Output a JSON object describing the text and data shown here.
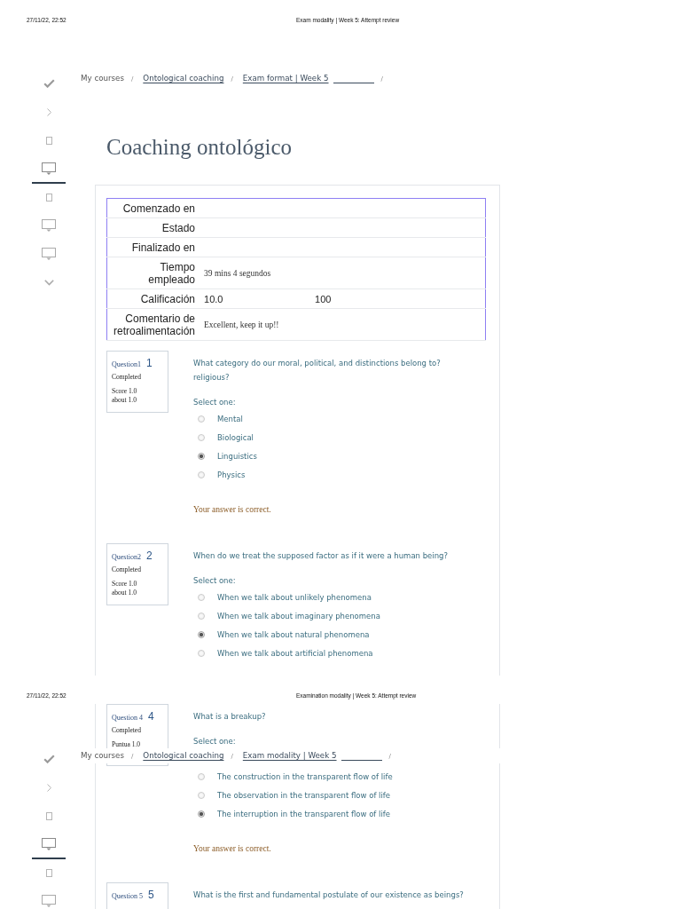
{
  "pages": [
    {
      "kind": "first",
      "header": {
        "date": "27/11/22, 22:52",
        "title": "Exam modality | Week 5: Attempt review"
      },
      "breadcrumb": [
        {
          "label": "My courses",
          "link": false,
          "underlined_blank": false,
          "separator": "/"
        },
        {
          "label": "Ontological coaching",
          "link": true,
          "underlined_blank": false,
          "separator": "/"
        },
        {
          "label": "Exam format | Week 5",
          "link": true,
          "underlined_blank": true,
          "separator": "/"
        }
      ],
      "sidebar": [
        {
          "kind": "check",
          "selected": false
        },
        {
          "kind": "chevron-right",
          "selected": false
        },
        {
          "kind": "document",
          "selected": false
        },
        {
          "kind": "monitor",
          "selected": true
        },
        {
          "kind": "document",
          "selected": false
        },
        {
          "kind": "monitor",
          "selected": false
        },
        {
          "kind": "monitor",
          "selected": false
        },
        {
          "kind": "chevron-down",
          "selected": false
        }
      ],
      "title": "Coaching ontológico",
      "summary": [
        {
          "kind": "empty",
          "label": "Comenzado en"
        },
        {
          "kind": "empty",
          "label": "Estado"
        },
        {
          "kind": "empty",
          "label": "Finalizado en"
        },
        {
          "kind": "note",
          "label": "Tiempo empleado",
          "value": "39 mins 4 segundos"
        },
        {
          "kind": "grade",
          "label": "Calificación",
          "value": "10.0",
          "value_2": "100"
        },
        {
          "kind": "note",
          "label": "Comentario de retroalimentación",
          "value": "Excellent, keep it up!!"
        }
      ],
      "questions": [
        {
          "label": "Question1",
          "number": "1",
          "status": "Completed",
          "score": "Score 1.0",
          "max_score": "about 1.0",
          "text": "What category do our moral, political, and distinctions belong to? religious?",
          "prompt": "Select one:",
          "options": [
            {
              "label": "Mental",
              "selected": false
            },
            {
              "label": "Biological",
              "selected": false
            },
            {
              "label": "Linguistics",
              "selected": true
            },
            {
              "label": "Physics",
              "selected": false
            }
          ],
          "feedback": "Your answer is correct."
        },
        {
          "label": "Question2",
          "number": "2",
          "status": "Completed",
          "score": "Score 1.0",
          "max_score": "about 1.0",
          "text": "When do we treat the supposed factor as if it were a human being?",
          "prompt": "Select one:",
          "options": [
            {
              "label": "When we talk about unlikely phenomena",
              "selected": false
            },
            {
              "label": "When we talk about imaginary phenomena",
              "selected": false
            },
            {
              "label": "When we talk about natural phenomena",
              "selected": true
            },
            {
              "label": "When we talk about artificial phenomena",
              "selected": false
            }
          ]
        }
      ]
    },
    {
      "kind": "continued",
      "header": {
        "date": "27/11/22, 22:52",
        "title": "Examination modality | Week 5: Attempt review"
      },
      "breadcrumb": [
        {
          "label": "My courses",
          "link": false,
          "underlined_blank": false,
          "separator": "/"
        },
        {
          "label": "Ontological coaching",
          "link": true,
          "underlined_blank": false,
          "separator": "/"
        },
        {
          "label": "Exam modality | Week 5",
          "link": true,
          "underlined_blank": true,
          "separator": "/"
        }
      ],
      "sidebar": [
        {
          "kind": "check",
          "selected": false
        },
        {
          "kind": "chevron-right",
          "selected": false
        },
        {
          "kind": "document",
          "selected": false
        },
        {
          "kind": "monitor",
          "selected": true
        },
        {
          "kind": "document",
          "selected": false
        },
        {
          "kind": "monitor",
          "selected": false
        }
      ],
      "questions": [
        {
          "label": "Question 4",
          "number": "4",
          "status": "Completed",
          "score": "Puntua 1.0",
          "text": "What is a breakup?",
          "prompt": "Select one:",
          "options": [
            {
              "label": "The construction in the transparent flow of life",
              "selected": false
            },
            {
              "label": "The observation in the transparent flow of life",
              "selected": false
            },
            {
              "label": "The interruption in the transparent flow of life",
              "selected": true
            }
          ],
          "feedback": "Your answer is correct."
        },
        {
          "label": "Question 5",
          "number": "5",
          "text": "What is the first and fundamental postulate of our existence as beings?"
        }
      ]
    }
  ]
}
